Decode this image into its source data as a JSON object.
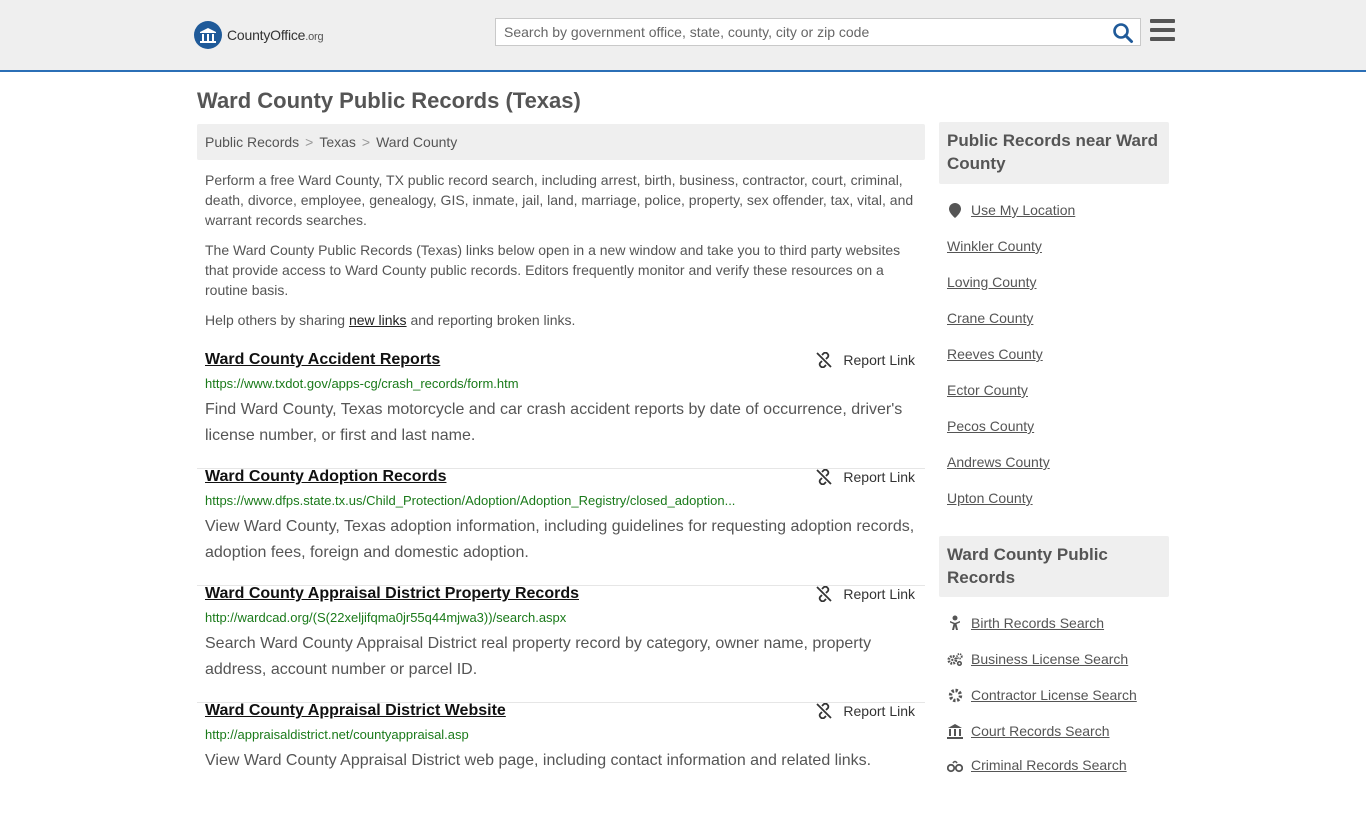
{
  "header": {
    "logo_main": "CountyOffice",
    "logo_tld": ".org",
    "search_placeholder": "Search by government office, state, county, city or zip code"
  },
  "page": {
    "title": "Ward County Public Records (Texas)",
    "breadcrumb": [
      "Public Records",
      "Texas",
      "Ward County"
    ],
    "intro1": "Perform a free Ward County, TX public record search, including arrest, birth, business, contractor, court, criminal, death, divorce, employee, genealogy, GIS, inmate, jail, land, marriage, police, property, sex offender, tax, vital, and warrant records searches.",
    "intro2": "The Ward County Public Records (Texas) links below open in a new window and take you to third party websites that provide access to Ward County public records. Editors frequently monitor and verify these resources on a routine basis.",
    "help_before": "Help others by sharing ",
    "help_link": "new links",
    "help_after": " and reporting broken links."
  },
  "report_label": "Report Link",
  "records": [
    {
      "title": "Ward County Accident Reports",
      "url": "https://www.txdot.gov/apps-cg/crash_records/form.htm",
      "desc": "Find Ward County, Texas motorcycle and car crash accident reports by date of occurrence, driver's license number, or first and last name."
    },
    {
      "title": "Ward County Adoption Records",
      "url": "https://www.dfps.state.tx.us/Child_Protection/Adoption/Adoption_Registry/closed_adoption...",
      "desc": "View Ward County, Texas adoption information, including guidelines for requesting adoption records, adoption fees, foreign and domestic adoption."
    },
    {
      "title": "Ward County Appraisal District Property Records",
      "url": "http://wardcad.org/(S(22xeljifqma0jr55q44mjwa3))/search.aspx",
      "desc": "Search Ward County Appraisal District real property record by category, owner name, property address, account number or parcel ID."
    },
    {
      "title": "Ward County Appraisal District Website",
      "url": "http://appraisaldistrict.net/countyappraisal.asp",
      "desc": "View Ward County Appraisal District web page, including contact information and related links."
    }
  ],
  "sidebar": {
    "near_title": "Public Records near Ward County",
    "use_location": "Use My Location",
    "nearby": [
      "Winkler County",
      "Loving County",
      "Crane County",
      "Reeves County",
      "Ector County",
      "Pecos County",
      "Andrews County",
      "Upton County"
    ],
    "records_title": "Ward County Public Records",
    "record_links": [
      {
        "label": "Birth Records Search",
        "icon": "baby-icon"
      },
      {
        "label": "Business License Search",
        "icon": "gears-icon"
      },
      {
        "label": "Contractor License Search",
        "icon": "gear-icon"
      },
      {
        "label": "Court Records Search",
        "icon": "courthouse-icon"
      },
      {
        "label": "Criminal Records Search",
        "icon": "handcuffs-icon"
      }
    ]
  },
  "colors": {
    "accent": "#2b6fb6",
    "logo": "#1f5a99",
    "url_green": "#1a7a1a",
    "panel_gray": "#efefef"
  }
}
